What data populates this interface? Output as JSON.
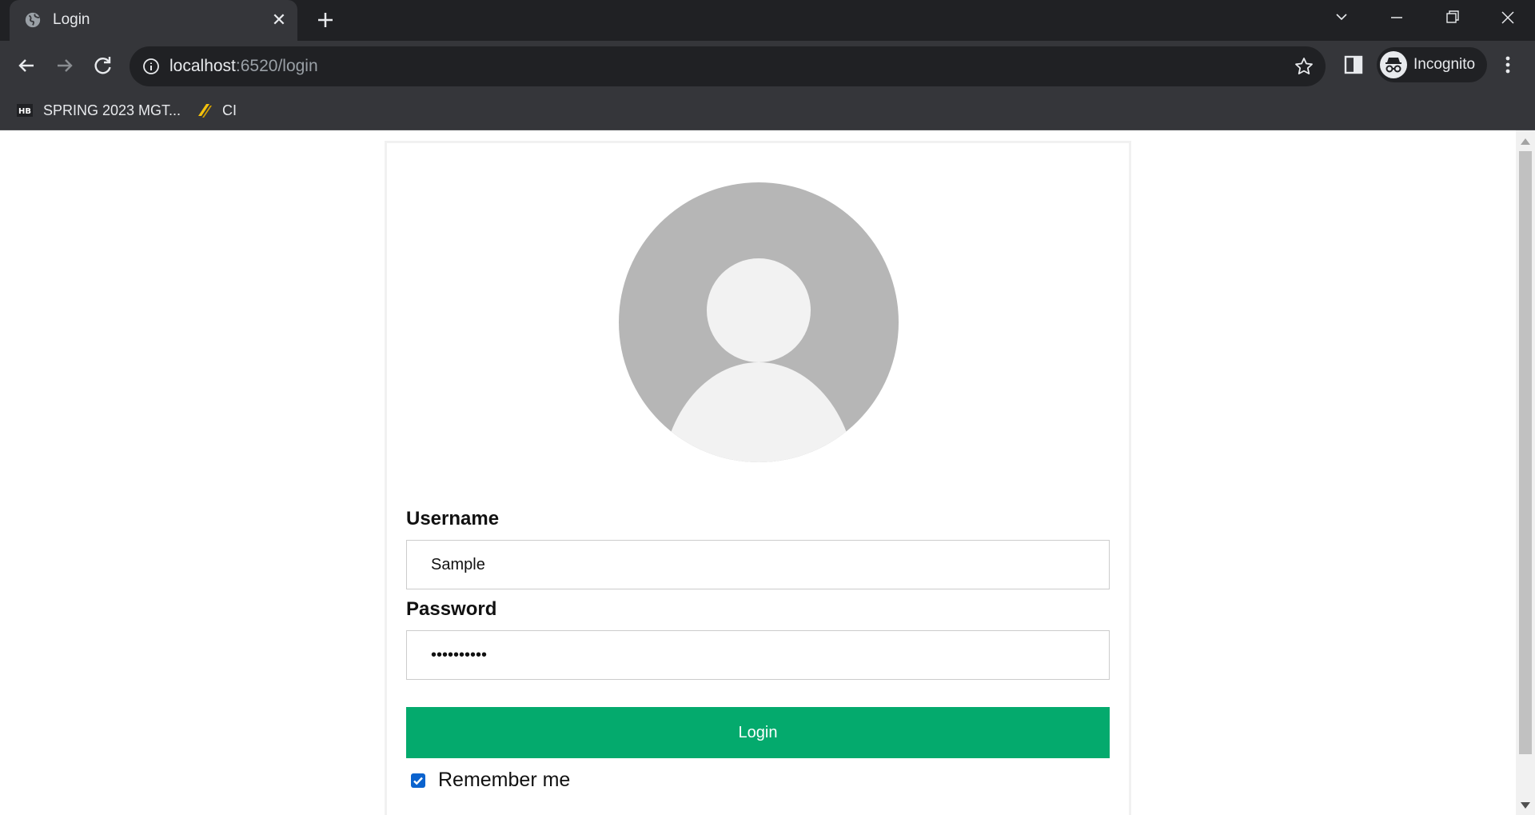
{
  "browser": {
    "tab_title": "Login",
    "url_host": "localhost",
    "url_path": ":6520/login",
    "profile_label": "Incognito",
    "bookmarks": [
      {
        "label": "SPRING 2023 MGT...",
        "icon": "hb-icon"
      },
      {
        "label": "CI",
        "icon": "ci-icon"
      }
    ]
  },
  "form": {
    "username_label": "Username",
    "username_value": "Sample",
    "password_label": "Password",
    "password_value": "••••••••••",
    "login_label": "Login",
    "remember_label": "Remember me",
    "remember_checked": true
  },
  "colors": {
    "login_button": "#04aa6d",
    "avatar_bg": "#b6b6b6",
    "avatar_fg": "#f2f2f2",
    "checkbox": "#0b63ce"
  }
}
